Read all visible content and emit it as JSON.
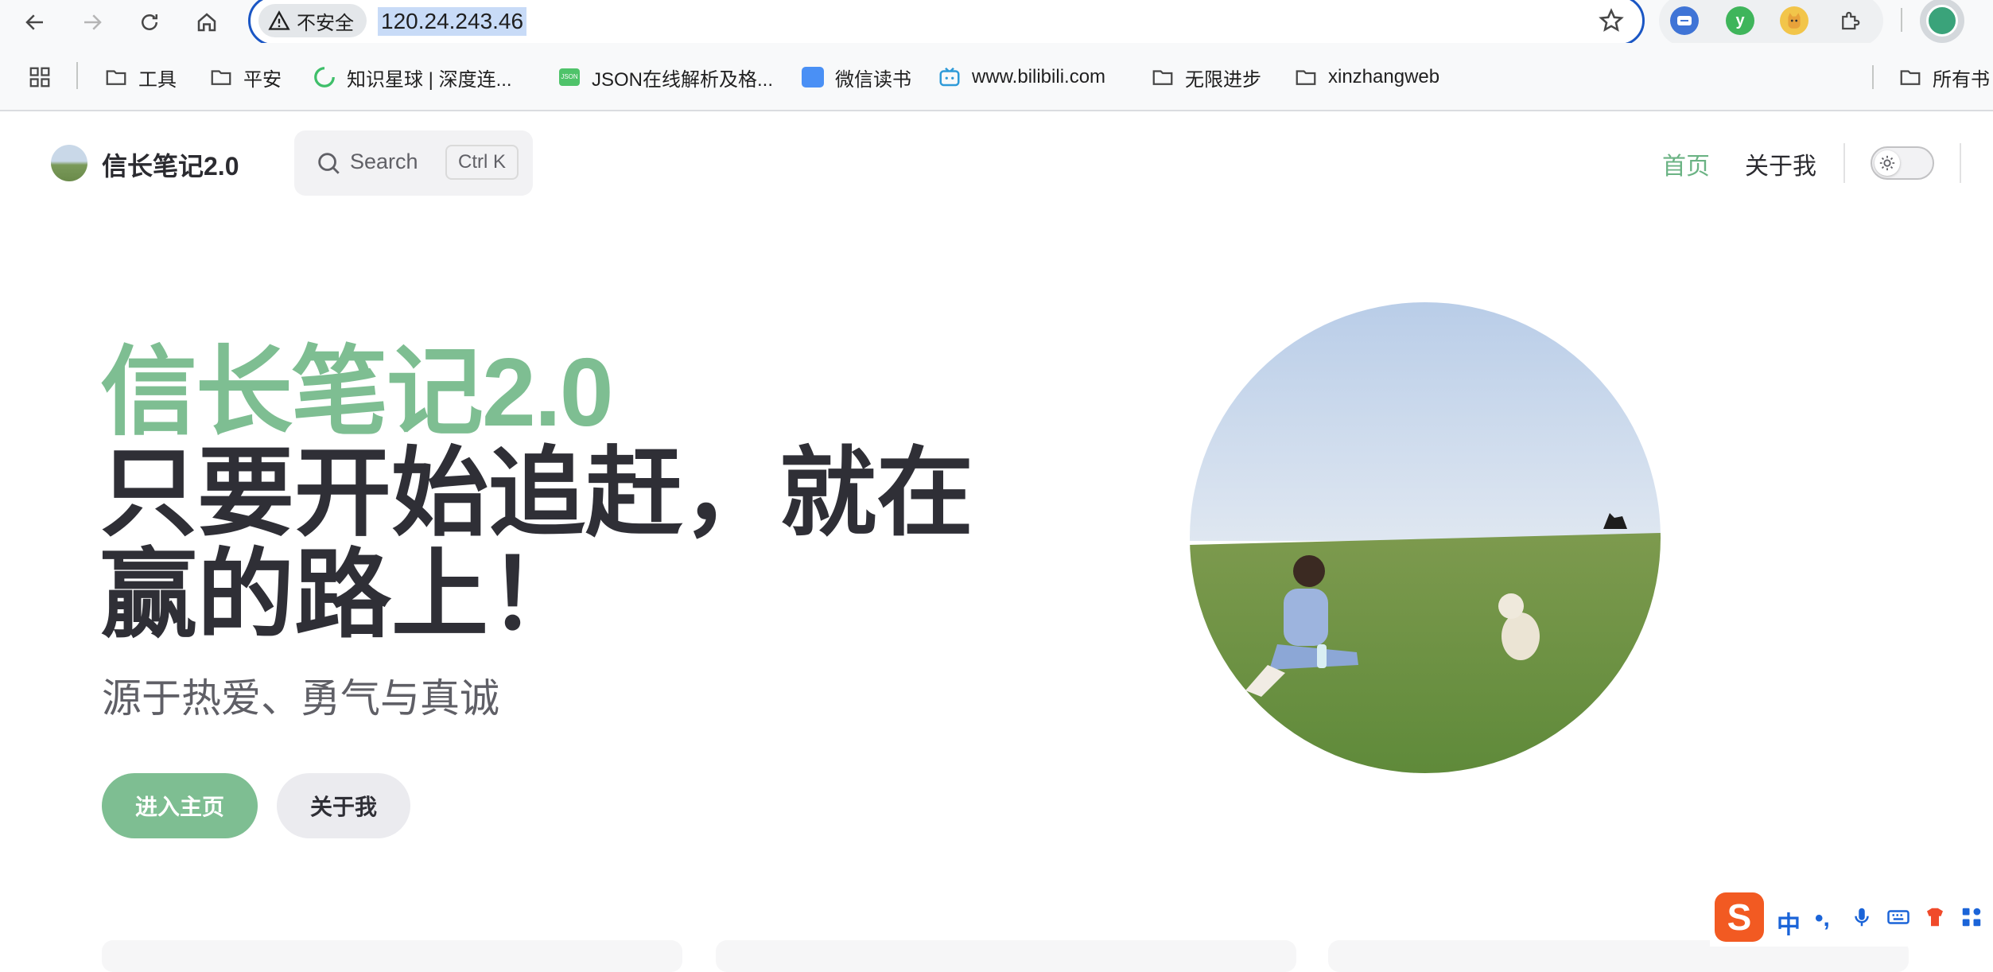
{
  "browser": {
    "security_label": "不安全",
    "url": "120.24.243.46",
    "bookmarks": [
      {
        "label": "工具",
        "icon": "folder-icon"
      },
      {
        "label": "平安",
        "icon": "folder-icon"
      },
      {
        "label": "知识星球 | 深度连...",
        "icon": "zsxq-icon"
      },
      {
        "label": "JSON在线解析及格...",
        "icon": "json-icon"
      },
      {
        "label": "微信读书",
        "icon": "weread-icon"
      },
      {
        "label": "www.bilibili.com",
        "icon": "bilibili-icon"
      },
      {
        "label": "无限进步",
        "icon": "folder-icon"
      },
      {
        "label": "xinzhangweb",
        "icon": "folder-icon"
      },
      {
        "label": "所有书",
        "icon": "folder-icon"
      }
    ],
    "extension_y_label": "y"
  },
  "site": {
    "title": "信长笔记2.0",
    "search": {
      "label": "Search",
      "shortcut": "Ctrl K"
    },
    "nav": [
      {
        "label": "首页",
        "active": true
      },
      {
        "label": "关于我",
        "active": false
      }
    ],
    "brand_color": "#7ebe92"
  },
  "hero": {
    "name": "信长笔记2.0",
    "text": "只要开始追赶，就在赢的路上！",
    "tagline": "源于热爱、勇气与真诚",
    "actions": [
      {
        "label": "进入主页",
        "theme": "brand"
      },
      {
        "label": "关于我",
        "theme": "alt"
      }
    ]
  },
  "ime": {
    "logo": "S",
    "mode": "中",
    "punct": "•,"
  }
}
